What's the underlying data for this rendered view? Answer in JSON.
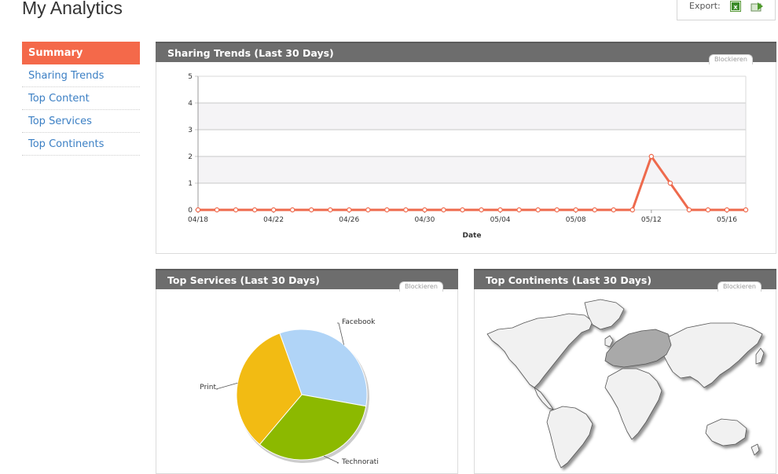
{
  "page": {
    "title": "My Analytics"
  },
  "export": {
    "label": "Export:"
  },
  "sidebar": {
    "items": [
      {
        "label": "Summary",
        "active": true
      },
      {
        "label": "Sharing Trends",
        "active": false
      },
      {
        "label": "Top Content",
        "active": false
      },
      {
        "label": "Top Services",
        "active": false
      },
      {
        "label": "Top Continents",
        "active": false
      }
    ]
  },
  "panels": {
    "trends": {
      "title": "Sharing Trends (Last 30 Days)",
      "block_label": "Blockieren"
    },
    "services": {
      "title": "Top Services (Last 30 Days)",
      "block_label": "Blockieren"
    },
    "continents": {
      "title": "Top Continents (Last 30 Days)",
      "block_label": "Blockieren"
    }
  },
  "colors": {
    "accent": "#f4694a",
    "link": "#3b7fc4",
    "header": "#6d6d6d",
    "line": "#ee6a4d",
    "facebook": "#b0d4f7",
    "technorati": "#8cb900",
    "print": "#f2bb13",
    "europe": "#a9a9a9"
  },
  "chart_data": [
    {
      "type": "line",
      "xlabel": "Date",
      "ylabel": "",
      "ylim": [
        0,
        5
      ],
      "yticks": [
        0,
        1,
        2,
        3,
        4,
        5
      ],
      "xtick_labels": [
        "04/18",
        "04/22",
        "04/26",
        "04/30",
        "05/04",
        "05/08",
        "05/12",
        "05/16"
      ],
      "x_dates": [
        "04/18",
        "04/19",
        "04/20",
        "04/21",
        "04/22",
        "04/23",
        "04/24",
        "04/25",
        "04/26",
        "04/27",
        "04/28",
        "04/29",
        "04/30",
        "05/01",
        "05/02",
        "05/03",
        "05/04",
        "05/05",
        "05/06",
        "05/07",
        "05/08",
        "05/09",
        "05/10",
        "05/11",
        "05/12",
        "05/13",
        "05/14",
        "05/15",
        "05/16",
        "05/17"
      ],
      "values": [
        0,
        0,
        0,
        0,
        0,
        0,
        0,
        0,
        0,
        0,
        0,
        0,
        0,
        0,
        0,
        0,
        0,
        0,
        0,
        0,
        0,
        0,
        0,
        0,
        2,
        1,
        0,
        0,
        0,
        0
      ],
      "grid": true
    },
    {
      "type": "pie",
      "slices": [
        {
          "label": "Facebook",
          "value": 1
        },
        {
          "label": "Technorati",
          "value": 1
        },
        {
          "label": "Print",
          "value": 1
        }
      ]
    }
  ]
}
